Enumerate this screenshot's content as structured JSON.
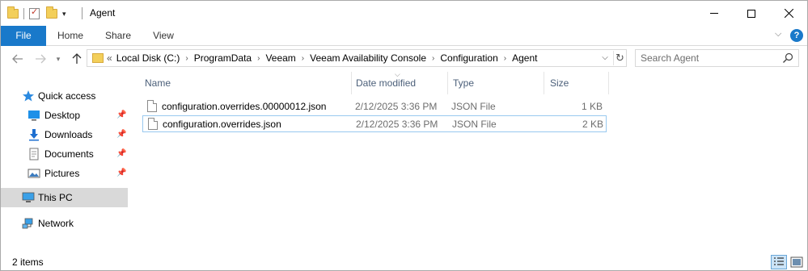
{
  "window": {
    "title": "Agent"
  },
  "ribbon": {
    "tabs": [
      "File",
      "Home",
      "Share",
      "View"
    ]
  },
  "address": {
    "overflow": "«",
    "crumbs": [
      "Local Disk (C:)",
      "ProgramData",
      "Veeam",
      "Veeam Availability Console",
      "Configuration",
      "Agent"
    ]
  },
  "search": {
    "placeholder": "Search Agent"
  },
  "sidebar": {
    "quick_access": "Quick access",
    "items": [
      {
        "label": "Desktop",
        "icon": "desktop-icon",
        "pinned": true
      },
      {
        "label": "Downloads",
        "icon": "downloads-icon",
        "pinned": true
      },
      {
        "label": "Documents",
        "icon": "documents-icon",
        "pinned": true
      },
      {
        "label": "Pictures",
        "icon": "pictures-icon",
        "pinned": true
      }
    ],
    "this_pc": "This PC",
    "network": "Network"
  },
  "columns": {
    "name": "Name",
    "date_modified": "Date modified",
    "type": "Type",
    "size": "Size"
  },
  "files": [
    {
      "name": "configuration.overrides.00000012.json",
      "date": "2/12/2025 3:36 PM",
      "type": "JSON File",
      "size": "1 KB"
    },
    {
      "name": "configuration.overrides.json",
      "date": "2/12/2025 3:36 PM",
      "type": "JSON File",
      "size": "2 KB"
    }
  ],
  "status": {
    "count": "2 items"
  },
  "colors": {
    "accent": "#1979ca",
    "selection": "#d9d9d9",
    "focus_border": "#99c9ef"
  }
}
